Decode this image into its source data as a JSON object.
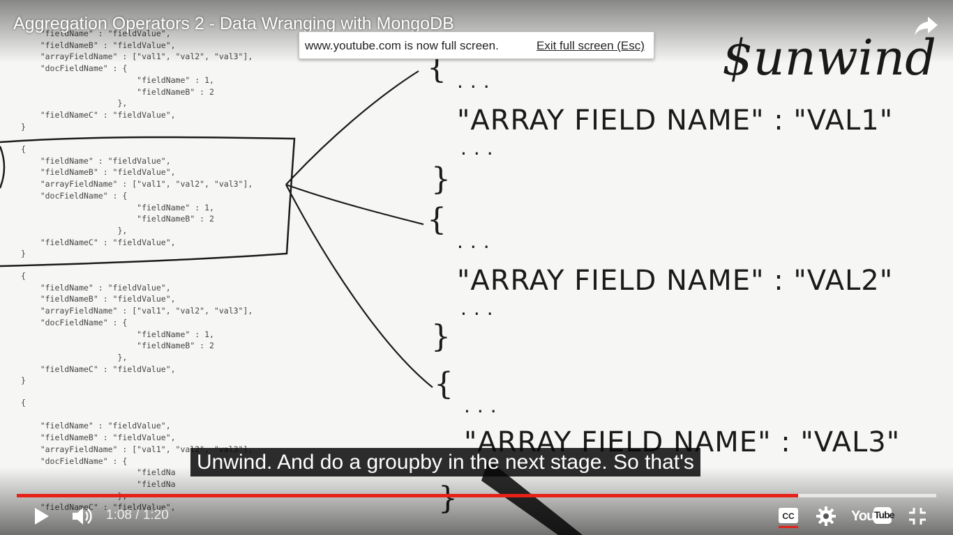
{
  "video": {
    "title": "Aggregation Operators 2 - Data Wranging with MongoDB",
    "caption": "Unwind. And do a groupby in the next stage. So that's"
  },
  "fullscreen_notice": {
    "message": "www.youtube.com is now full screen.",
    "exit_label": "Exit full screen (Esc)"
  },
  "player": {
    "current_time": "1:08",
    "duration": "1:20",
    "time_display": "1:08 / 1:20",
    "played_fraction": 0.85,
    "loaded_fraction": 1.0,
    "progress_color": "#e62117",
    "logo_you": "You",
    "logo_tube": "Tube",
    "icons": [
      "play-icon",
      "volume-icon",
      "cc-icon",
      "settings-icon",
      "youtube-logo",
      "exit-fullscreen-icon",
      "share-icon"
    ]
  },
  "whiteboard": {
    "heading": "$unwind",
    "code_block_1": "    \"fieldName\" : \"fieldValue\",\n    \"fieldNameB\" : \"fieldValue\",\n    \"arrayFieldName\" : [\"val1\", \"val2\", \"val3\"],\n    \"docFieldName\" : {\n                        \"fieldName\" : 1,\n                        \"fieldNameB\" : 2\n                    },\n    \"fieldNameC\" : \"fieldValue\",\n}",
    "code_block_2": "{\n    \"fieldName\" : \"fieldValue\",\n    \"fieldNameB\" : \"fieldValue\",\n    \"arrayFieldName\" : [\"val1\", \"val2\", \"val3\"],\n    \"docFieldName\" : {\n                        \"fieldName\" : 1,\n                        \"fieldNameB\" : 2\n                    },\n    \"fieldNameC\" : \"fieldValue\",\n}",
    "code_block_3": "{\n    \"fieldName\" : \"fieldValue\",\n    \"fieldNameB\" : \"fieldValue\",\n    \"arrayFieldName\" : [\"val1\", \"val2\", \"val3\"],\n    \"docFieldName\" : {\n                        \"fieldName\" : 1,\n                        \"fieldNameB\" : 2\n                    },\n    \"fieldNameC\" : \"fieldValue\",\n}",
    "code_block_4": "{\n\n    \"fieldName\" : \"fieldValue\",\n    \"fieldNameB\" : \"fieldValue\",\n    \"arrayFieldName\" : [\"val1\", \"val2\", \"val3\"],\n    \"docFieldName\" : {\n                        \"fieldNa\n                        \"fieldNa\n                    },\n    \"fieldNameC\" : \"fieldValue\",",
    "open_brace": "{",
    "close_brace": "}",
    "dots": "...",
    "line_1": "\"ARRAY FIELD NAME\" : \"VAL1\"",
    "line_2": "\"ARRAY FIELD NAME\" : \"VAL2\"",
    "line_3": "\"ARRAY FIELD NAME\" : \"VAL3\""
  }
}
